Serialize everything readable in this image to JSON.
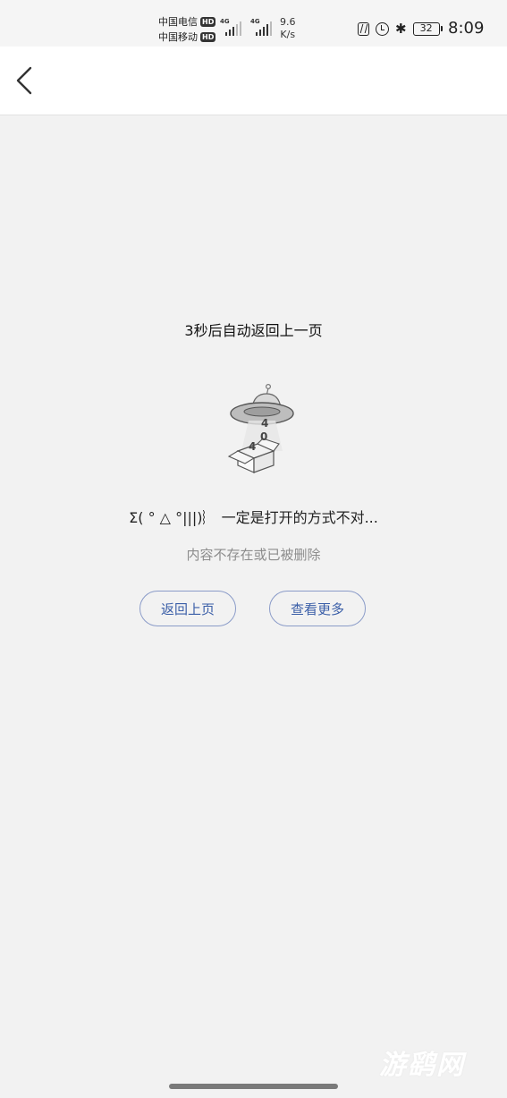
{
  "status_bar": {
    "carrier1": "中国电信",
    "carrier2": "中国移动",
    "hd_badge": "HD",
    "network_type": "4G",
    "speed_value": "9.6",
    "speed_unit": "K/s",
    "battery_level": "32",
    "time": "8:09"
  },
  "page": {
    "countdown_text": "3秒后自动返回上一页",
    "illustration_digits": [
      "4",
      "0",
      "4"
    ],
    "error_title": "Σ( ° △ °|||)︴ 一定是打开的方式不对...",
    "error_subtitle": "内容不存在或已被删除",
    "back_button_label": "返回上页",
    "more_button_label": "查看更多"
  },
  "watermark": "游鹞网",
  "colors": {
    "background": "#f2f2f2",
    "button_border": "#8a9bc8",
    "button_text": "#3b5fa8",
    "subtitle": "#8c8c8c"
  }
}
